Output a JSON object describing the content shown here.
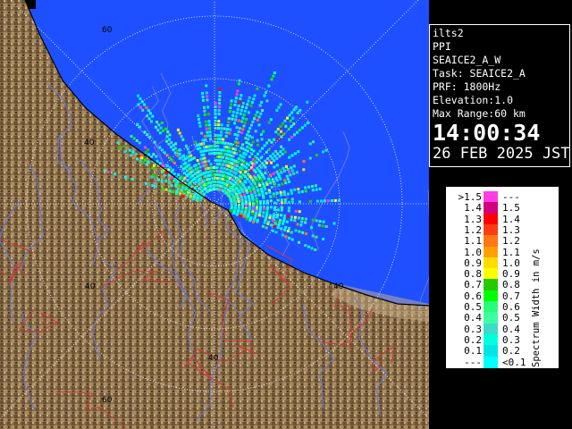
{
  "info": {
    "station": "ilts2",
    "mode": "PPI",
    "scan_name": "SEAICE2_A_W",
    "task": "Task: SEAICE2_A",
    "prf": "PRF: 1800Hz",
    "elevation": "Elevation:1.0",
    "max_range": "Max Range:60 km",
    "time": "14:00:34",
    "date": "26 FEB 2025 JST"
  },
  "range_ring_labels": {
    "ring40_a": "40",
    "ring40_b": "40",
    "ring40_c": "40",
    "ring40_d": "40",
    "ring60_top": "60",
    "ring60_bottom": "60"
  },
  "legend": {
    "title": "Spectrum Width in m/s",
    "rows": [
      {
        "left": ">1.5",
        "right": "---",
        "color": "#ff3ce6"
      },
      {
        "left": "1.4",
        "right": "1.5",
        "color": "#d2007a"
      },
      {
        "left": "1.3",
        "right": "1.4",
        "color": "#ff0000"
      },
      {
        "left": "1.2",
        "right": "1.3",
        "color": "#ff3c14"
      },
      {
        "left": "1.1",
        "right": "1.2",
        "color": "#ff7814"
      },
      {
        "left": "1.0",
        "right": "1.1",
        "color": "#ffa000"
      },
      {
        "left": "0.9",
        "right": "1.0",
        "color": "#ffdc00"
      },
      {
        "left": "0.8",
        "right": "0.9",
        "color": "#ffff00"
      },
      {
        "left": "0.7",
        "right": "0.8",
        "color": "#28c800"
      },
      {
        "left": "0.6",
        "right": "0.7",
        "color": "#00ff00"
      },
      {
        "left": "0.5",
        "right": "0.6",
        "color": "#28ff78"
      },
      {
        "left": "0.4",
        "right": "0.5",
        "color": "#3cffa0"
      },
      {
        "left": "0.3",
        "right": "0.4",
        "color": "#3cdcc8"
      },
      {
        "left": "0.2",
        "right": "0.3",
        "color": "#00ffdc"
      },
      {
        "left": "0.1",
        "right": "0.2",
        "color": "#00e6e6"
      },
      {
        "left": "---",
        "right": "<0.1",
        "color": "#00ffff"
      }
    ]
  },
  "colors": {
    "sea": "#1e50ff",
    "land": "#8a6e48",
    "rings": "#ffffff",
    "rivers": "#6a78d8",
    "boundaries": "#c83c3c"
  }
}
